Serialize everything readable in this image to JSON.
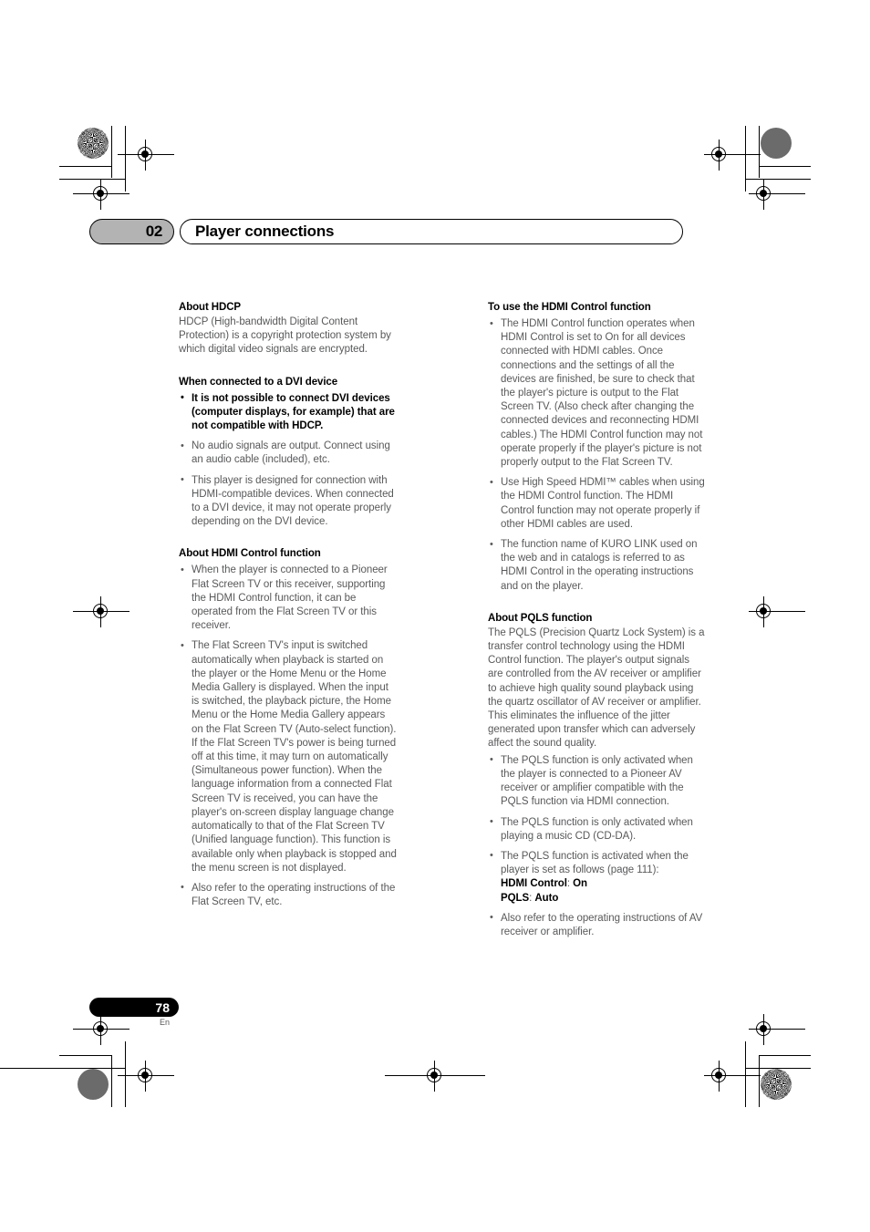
{
  "header": {
    "chapter_number": "02",
    "chapter_title": "Player connections"
  },
  "footer": {
    "page_number": "78",
    "language_code": "En"
  },
  "left_column": {
    "sections": [
      {
        "heading": "About HDCP",
        "paragraph": "HDCP (High-bandwidth Digital Content Protection) is a copyright protection system by which digital video signals are encrypted."
      },
      {
        "heading": "When connected to a DVI device",
        "bullets": [
          "It is not possible to connect DVI devices (computer displays, for example) that are not compatible with HDCP.",
          "No audio signals are output. Connect using an audio cable (included), etc.",
          "This player is designed for connection with HDMI-compatible devices. When connected to a DVI device, it may not operate properly depending on the DVI device."
        ]
      },
      {
        "heading": "About HDMI Control function",
        "bullets": [
          "When the player is connected to a Pioneer Flat Screen TV or this receiver, supporting the HDMI Control function, it can be operated from the Flat Screen TV or this receiver.",
          "The Flat Screen TV's input is switched automatically when playback is started on the player or the Home Menu or the Home Media Gallery is displayed. When the input is switched, the playback picture, the Home Menu or the Home Media Gallery appears on the Flat Screen TV (Auto-select function). If the Flat Screen TV's power is being turned off at this time, it may turn on automatically (Simultaneous power function). When the language information from a connected Flat Screen TV is received, you can have the player's on-screen display language change automatically to that of the Flat Screen TV (Unified language function). This function is available only when playback is stopped and the menu screen is not displayed.",
          "Also refer to the operating instructions of the Flat Screen TV, etc."
        ]
      }
    ]
  },
  "right_column": {
    "sections": [
      {
        "heading": "To use the HDMI Control function",
        "bullets": [
          "The HDMI Control function operates when HDMI Control is set to On for all devices connected with HDMI cables. Once connections and the settings of all the devices are finished, be sure to check that the player's picture is output to the Flat Screen TV. (Also check after changing the connected devices and reconnecting HDMI cables.) The HDMI Control function may not operate properly if the player's picture is not properly output to the Flat Screen TV.",
          "Use High Speed HDMI™ cables when using the HDMI Control function. The HDMI Control function may not operate properly if other HDMI cables are used.",
          "The function name of KURO LINK used on the web and in catalogs is referred to as HDMI Control in the operating instructions and on the player."
        ]
      },
      {
        "heading": "About PQLS function",
        "paragraph": "The PQLS (Precision Quartz Lock System) is a transfer control technology using the HDMI Control function. The player's output signals are controlled from the AV receiver or amplifier to achieve high quality sound playback using the quartz oscillator of AV receiver or amplifier. This eliminates the influence of the jitter generated upon transfer which can adversely affect the sound quality.",
        "bullets": [
          "The PQLS function is only activated when the player is connected to a Pioneer AV receiver or amplifier compatible with the PQLS function via HDMI connection.",
          "The PQLS function is only activated when playing a music CD (CD-DA).",
          "Also refer to the operating instructions of AV receiver or amplifier."
        ],
        "settings_bullet": {
          "intro": "The PQLS function is activated when the player is set as follows (page 111):",
          "setting_1_label": "HDMI Control",
          "setting_1_value": "On",
          "setting_2_label": "PQLS",
          "setting_2_value": "Auto"
        }
      }
    ]
  }
}
